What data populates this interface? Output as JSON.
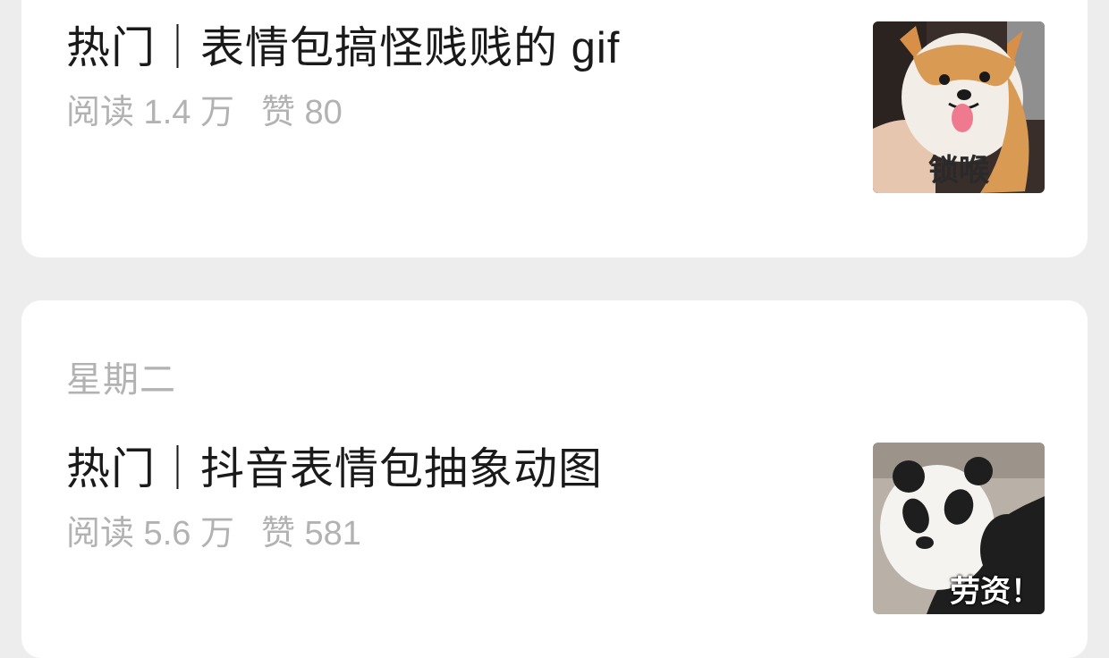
{
  "articles": [
    {
      "title": "热门｜表情包搞怪贱贱的 gif",
      "reads": "阅读 1.4 万",
      "likes": "赞 80",
      "thumb_caption": "锁喉",
      "thumb_icon": "corgi-meme-image"
    },
    {
      "day_label": "星期二",
      "title": "热门｜抖音表情包抽象动图",
      "reads": "阅读 5.6 万",
      "likes": "赞 581",
      "thumb_caption": "劳资！",
      "thumb_icon": "panda-meme-image"
    }
  ],
  "colors": {
    "page_background": "#ededed",
    "card_background": "#ffffff",
    "title_text": "#1a1a1a",
    "meta_text": "#b2b2b2"
  }
}
